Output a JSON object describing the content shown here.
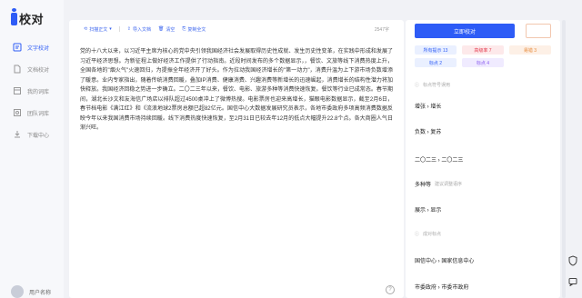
{
  "app": {
    "logo_text": "校对"
  },
  "sidebar": {
    "items": [
      {
        "label": "文字校对",
        "icon": "text-proof-icon",
        "active": true
      },
      {
        "label": "文档校对",
        "icon": "document-icon",
        "active": false
      },
      {
        "label": "我的词库",
        "icon": "library-icon",
        "active": false
      },
      {
        "label": "团队词库",
        "icon": "team-icon",
        "active": false
      },
      {
        "label": "下载中心",
        "icon": "download-icon",
        "active": false
      }
    ],
    "user_name": "用户名称"
  },
  "toolbar": {
    "scan_label": "扫描正文",
    "import_label": "导入文档",
    "clear_label": "清空",
    "copy_label": "复制全文",
    "word_count": "2547字"
  },
  "editor": {
    "paragraphs": [
      "党的十八大以来，以习近平主席为核心的党中央引领我国经济社会发展取得历史性成就、发生历史性变革，在实践中形成和发展了习近平经济思想。为新征程上做好经济工作提供了行动指南。近段时间发布的多个数据显示，，餐饮、文旅等线下消费热度上升，全国各地的\"烟火气\"火速回归，为提振全年经济开了好头。作为拉动我国经济增长的\"第一动力\"，消费升温为上下游市场负数增添了暖意。业内专家指出，随着传统消费回暖，叠加IP消费、健康消费、兴趣消费等新增长的迅速崛起，消费增长的结构性潜力将加快释放。我国经济回稳之势进一步确立。二〇二三年以来，餐饮、电影、旅游多种等消费快速恢复。餐饮等行业已成常态。春节期间，湖北长沙文和友海信广场店以排队超过4500桌冲上了微博热搜。电影票房也迎来高增长，猫眼电影数据显示，截至2月6日，春节档电影《满江红》和《流浪地球2票房总额已超82亿元。国信中心大数据发展研究员表示，各地市委政府多项高频消费数据反映今年以来我国消费市场持续回暖。线下消费热度快速恢复，至2月31日已较去年12月的低点大幅提升22.8个点。各大商圈人气日渐兴旺。"
    ]
  },
  "right_panel": {
    "primary_button": "立即校对",
    "secondary_button": "",
    "chips": [
      {
        "label": "所有提示 13",
        "tone": "blue"
      },
      {
        "label": "高级率 7",
        "tone": "red"
      },
      {
        "label": "易错 3",
        "tone": "orange"
      },
      {
        "label": "标点 2",
        "tone": "blue"
      },
      {
        "label": "标点 4",
        "tone": "purple"
      }
    ],
    "rows": [
      {
        "main": "标点符号误用",
        "meta": "",
        "faded": true
      },
      {
        "main": "增张 › 增长",
        "meta": ""
      },
      {
        "main": "负数 › 复苏",
        "meta": ""
      },
      {
        "main": "二〇二三 › 二〇二三",
        "meta": ""
      },
      {
        "main": "多种等",
        "meta": "建议调整语序"
      },
      {
        "main": "展示 › 显示",
        "meta": ""
      },
      {
        "main": "成对标点",
        "meta": "",
        "faded": true
      },
      {
        "main": "国信中心 › 国家信息中心",
        "meta": ""
      },
      {
        "main": "市委政府 › 市委市政府",
        "meta": ""
      }
    ]
  }
}
